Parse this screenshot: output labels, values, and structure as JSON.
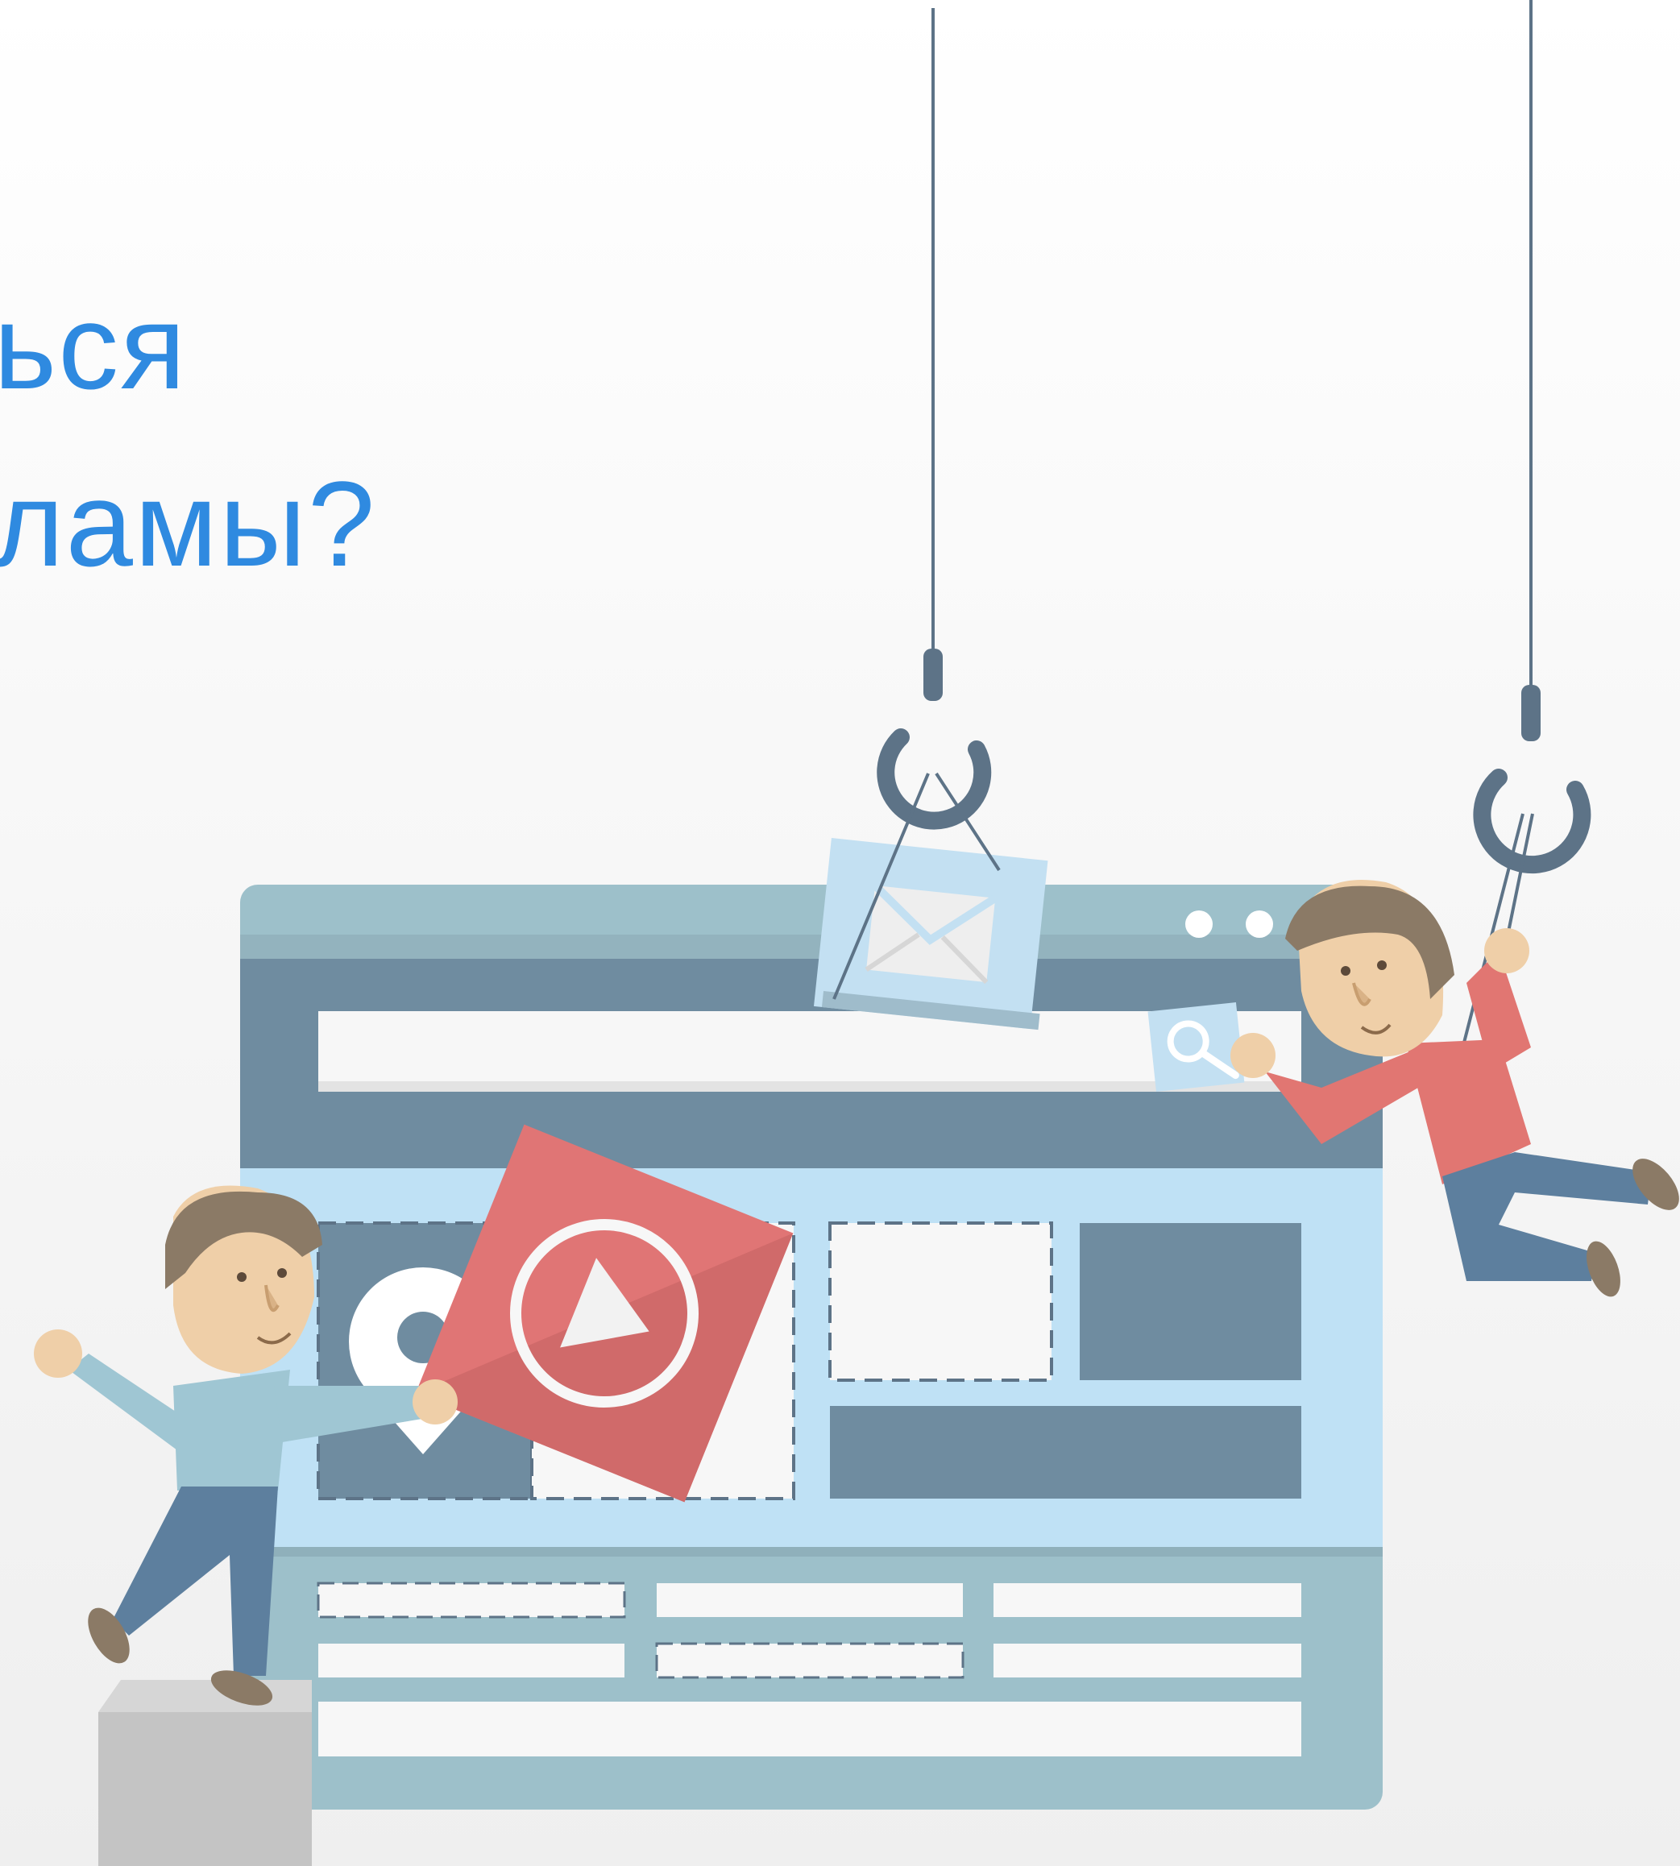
{
  "headline": {
    "line1": "ься",
    "line2": "ламы?"
  },
  "colors": {
    "headline": "#2f8ae0",
    "browser_frame": "#9dc0ca",
    "browser_dark": "#6f8ca0",
    "panel_light": "#bfe1f5",
    "card_white": "#f7f7f7",
    "play_red": "#e07575",
    "shirt_red": "#e17672",
    "shirt_blue": "#9fc6d3",
    "skin": "#efcfa8",
    "hair": "#8b7a66",
    "pants": "#5d7f9e",
    "hook": "#5d7387",
    "pedestal": "#c4c4c4"
  },
  "icons": [
    "envelope-icon",
    "search-icon",
    "play-icon",
    "location-pin-icon",
    "hook-icon"
  ]
}
